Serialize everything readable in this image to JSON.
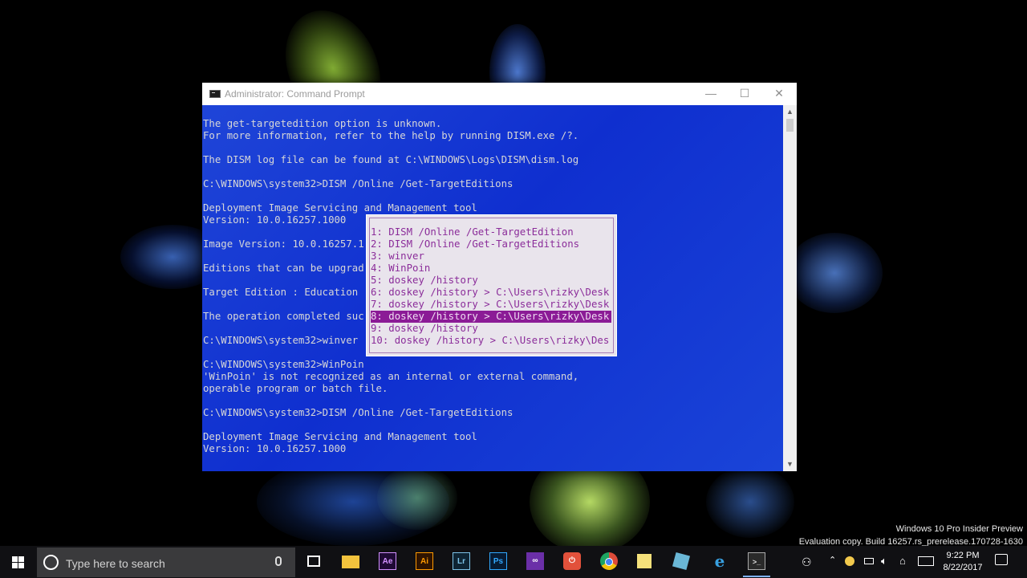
{
  "window": {
    "title": "Administrator: Command Prompt",
    "controls": {
      "minimize": "—",
      "maximize": "☐",
      "close": "✕"
    }
  },
  "console": {
    "lines": [
      "The get-targetedition option is unknown.",
      "For more information, refer to the help by running DISM.exe /?.",
      "",
      "The DISM log file can be found at C:\\WINDOWS\\Logs\\DISM\\dism.log",
      "",
      "C:\\WINDOWS\\system32>DISM /Online /Get-TargetEditions",
      "",
      "Deployment Image Servicing and Management tool",
      "Version: 10.0.16257.1000",
      "",
      "Image Version: 10.0.16257.1",
      "",
      "Editions that can be upgrad",
      "",
      "Target Edition : Education",
      "",
      "The operation completed suc",
      "",
      "C:\\WINDOWS\\system32>winver",
      "",
      "C:\\WINDOWS\\system32>WinPoin",
      "'WinPoin' is not recognized as an internal or external command,",
      "operable program or batch file.",
      "",
      "C:\\WINDOWS\\system32>DISM /Online /Get-TargetEditions",
      "",
      "Deployment Image Servicing and Management tool",
      "Version: 10.0.16257.1000"
    ]
  },
  "history_popup": {
    "selected_index": 7,
    "items": [
      "1: DISM /Online /Get-TargetEdition",
      "2: DISM /Online /Get-TargetEditions",
      "3: winver",
      "4: WinPoin",
      "5: doskey /history",
      "6: doskey /history > C:\\Users\\rizky\\Desk",
      "7: doskey /history > C:\\Users\\rizky\\Desk",
      "8: doskey /history > C:\\Users\\rizky\\Desk",
      "9: doskey /history",
      "10: doskey /history > C:\\Users\\rizky\\Des"
    ]
  },
  "watermark": {
    "line1": "Windows 10 Pro Insider Preview",
    "line2": "Evaluation copy. Build 16257.rs_prerelease.170728-1630"
  },
  "taskbar": {
    "search_placeholder": "Type here to search",
    "pinned": [
      {
        "name": "task-view-icon",
        "label": "",
        "color": "#ffffff"
      },
      {
        "name": "file-explorer-icon",
        "label": "",
        "color": "#f3c33d"
      },
      {
        "name": "after-effects-icon",
        "label": "Ae",
        "color": "#1f0a35"
      },
      {
        "name": "illustrator-icon",
        "label": "Ai",
        "color": "#2f1400"
      },
      {
        "name": "lightroom-icon",
        "label": "Lr",
        "color": "#0e2433"
      },
      {
        "name": "photoshop-icon",
        "label": "Ps",
        "color": "#071b33"
      },
      {
        "name": "visual-studio-icon",
        "label": "",
        "color": "#6b2fa8"
      },
      {
        "name": "power-app-icon",
        "label": "",
        "color": "#e2513b"
      },
      {
        "name": "chrome-icon",
        "label": "",
        "color": "#dd4b39"
      },
      {
        "name": "sticky-notes-icon",
        "label": "",
        "color": "#f5e17b"
      },
      {
        "name": "app-icon",
        "label": "",
        "color": "#6ab7d6"
      },
      {
        "name": "internet-explorer-icon",
        "label": "",
        "color": "#38a0e0"
      },
      {
        "name": "command-prompt-icon",
        "label": "",
        "color": "#2a2a2a"
      }
    ],
    "clock": {
      "time": "9:22 PM",
      "date": "8/22/2017"
    }
  }
}
